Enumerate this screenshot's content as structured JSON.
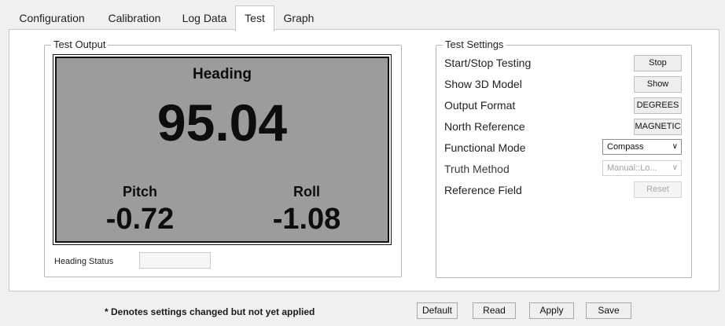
{
  "tabs": [
    "Configuration",
    "Calibration",
    "Log Data",
    "Test",
    "Graph"
  ],
  "active_tab": "Test",
  "test_output": {
    "title": "Test Output",
    "heading_label": "Heading",
    "heading_value": "95.04",
    "pitch_label": "Pitch",
    "pitch_value": "-0.72",
    "roll_label": "Roll",
    "roll_value": "-1.08",
    "heading_status_label": "Heading Status",
    "heading_status_value": ""
  },
  "test_settings": {
    "title": "Test Settings",
    "rows": [
      {
        "label": "Start/Stop Testing",
        "control": "Stop"
      },
      {
        "label": "Show 3D Model",
        "control": "Show"
      },
      {
        "label": "Output Format",
        "control": "DEGREES"
      },
      {
        "label": "North Reference",
        "control": "MAGNETIC"
      },
      {
        "label": "Functional Mode",
        "control": "Compass"
      },
      {
        "label": "Truth Method",
        "control": "Manual::Lo..."
      },
      {
        "label": "Reference Field",
        "control": "Reset"
      }
    ]
  },
  "footer": {
    "note": "* Denotes settings changed but not yet applied",
    "buttons": [
      "Default",
      "Read",
      "Apply",
      "Save"
    ]
  },
  "colors": {
    "display_bg": "#9c9c9c",
    "panel_bg": "#ffffff",
    "window_bg": "#f0f0f0"
  }
}
